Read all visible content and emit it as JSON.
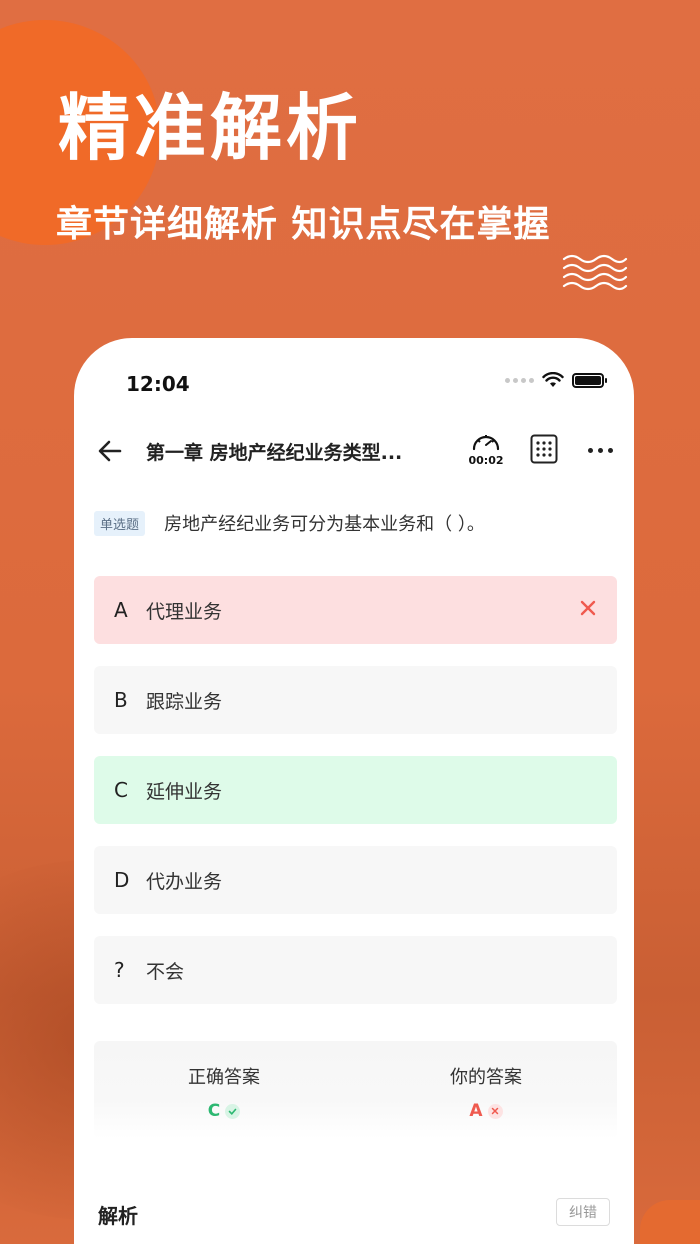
{
  "promo": {
    "headline": "精准解析",
    "subline": "章节详细解析  知识点尽在掌握"
  },
  "status_bar": {
    "time": "12:04",
    "icons": [
      "signal-dots-icon",
      "wifi-icon",
      "battery-icon"
    ]
  },
  "nav": {
    "back_icon": "arrow-left-icon",
    "title": "第一章   房地产经纪业务类型...",
    "timer": "00:02",
    "icons": [
      "stopwatch-icon",
      "grid-icon",
      "more-icon"
    ]
  },
  "question": {
    "type": "单选题",
    "text": "房地产经纪业务可分为基本业务和（      ）。"
  },
  "options": [
    {
      "letter": "A",
      "text": "代理业务",
      "state": "wrong"
    },
    {
      "letter": "B",
      "text": "跟踪业务",
      "state": "normal"
    },
    {
      "letter": "C",
      "text": "延伸业务",
      "state": "correct"
    },
    {
      "letter": "D",
      "text": "代办业务",
      "state": "normal"
    },
    {
      "letter": "?",
      "text": "不会",
      "state": "normal"
    }
  ],
  "answers": {
    "correct_label": "正确答案",
    "correct_value": "C",
    "yours_label": "你的答案",
    "yours_value": "A"
  },
  "analysis": {
    "title": "解析",
    "report_button": "纠错"
  },
  "colors": {
    "background": "#de6b3d",
    "accent_circle": "#f06a28",
    "wrong_bg": "#fddfe0",
    "correct_bg": "#defbe9",
    "correct_text": "#2db872",
    "wrong_text": "#ef5a4f"
  }
}
